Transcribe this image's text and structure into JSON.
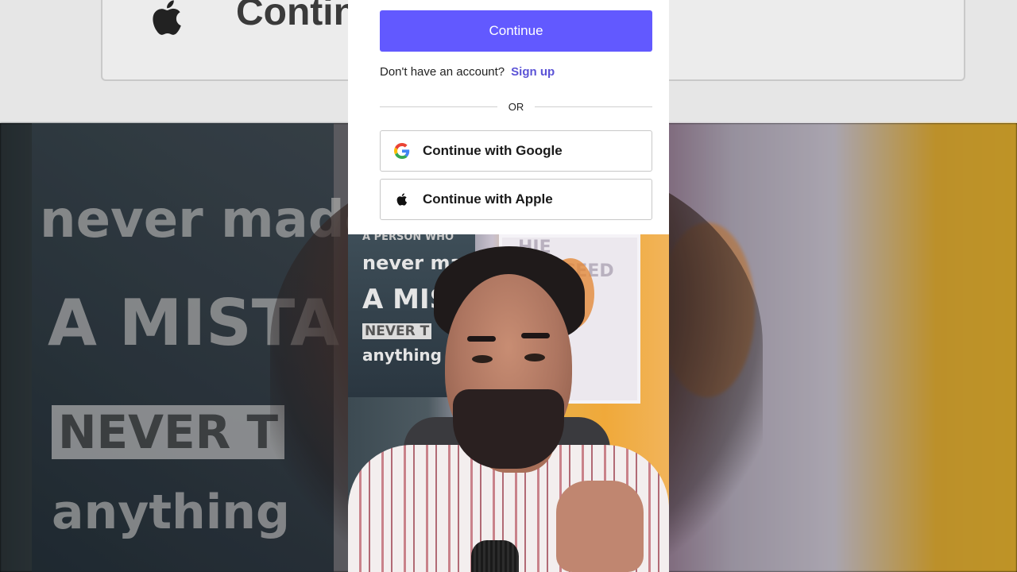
{
  "auth": {
    "continue_label": "Continue",
    "signup_prompt": "Don't have an account?",
    "signup_link": "Sign up",
    "divider_text": "OR",
    "google_label": "Continue with Google",
    "apple_label": "Continue with Apple"
  },
  "background": {
    "top_button_fragment": "Contin",
    "poster_lines": [
      "never made",
      "A MISTA",
      "NEVER T",
      "anything"
    ]
  },
  "video_frame": {
    "poster_lines": [
      "A PERSON WHO",
      "never made",
      "A MISTA",
      "NEVER T",
      "anything"
    ],
    "board_text": [
      "HIE",
      "CCEED"
    ]
  },
  "colors": {
    "primary": "#6259ff",
    "link": "#5b53d6",
    "google_blue": "#4285F4",
    "google_red": "#EA4335",
    "google_yellow": "#FBBC05",
    "google_green": "#34A853"
  },
  "icons": [
    "google-logo-icon",
    "apple-logo-icon"
  ]
}
